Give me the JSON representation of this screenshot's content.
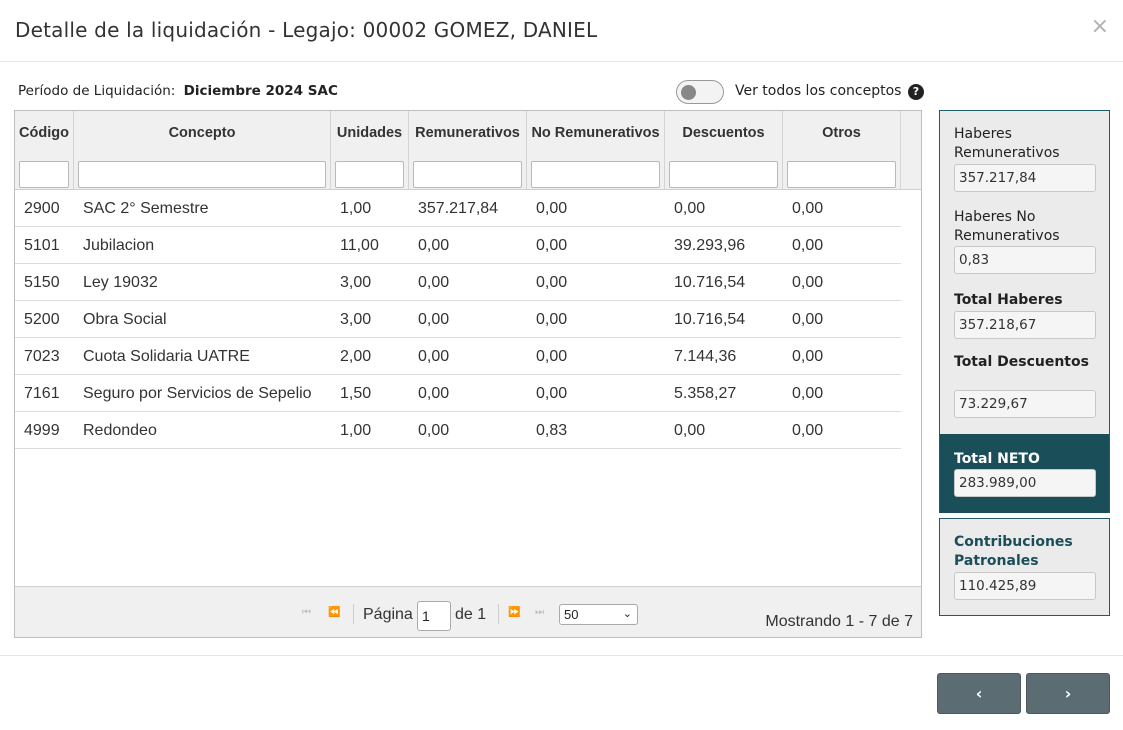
{
  "header": {
    "title": "Detalle de la liquidación - Legajo: 00002 GOMEZ, DANIEL",
    "close_glyph": "×"
  },
  "period": {
    "label": "Período de Liquidación:",
    "value": "Diciembre 2024 SAC"
  },
  "toggle": {
    "label": "Ver todos los conceptos",
    "checked": false
  },
  "help_glyph": "?",
  "table": {
    "columns": [
      "Código",
      "Concepto",
      "Unidades",
      "Remunerativos",
      "No Remunerativos",
      "Descuentos",
      "Otros"
    ],
    "rows": [
      [
        "2900",
        "SAC 2° Semestre",
        "1,00",
        "357.217,84",
        "0,00",
        "0,00",
        "0,00"
      ],
      [
        "5101",
        "Jubilacion",
        "11,00",
        "0,00",
        "0,00",
        "39.293,96",
        "0,00"
      ],
      [
        "5150",
        "Ley 19032",
        "3,00",
        "0,00",
        "0,00",
        "10.716,54",
        "0,00"
      ],
      [
        "5200",
        "Obra Social",
        "3,00",
        "0,00",
        "0,00",
        "10.716,54",
        "0,00"
      ],
      [
        "7023",
        "Cuota Solidaria UATRE",
        "2,00",
        "0,00",
        "0,00",
        "7.144,36",
        "0,00"
      ],
      [
        "7161",
        "Seguro por Servicios de Sepelio",
        "1,50",
        "0,00",
        "0,00",
        "5.358,27",
        "0,00"
      ],
      [
        "4999",
        "Redondeo",
        "1,00",
        "0,00",
        "0,83",
        "0,00",
        "0,00"
      ]
    ]
  },
  "pager": {
    "page_label": "Página",
    "page_value": "1",
    "of_label": "de 1",
    "page_size": "50",
    "info": "Mostrando 1 - 7 de 7",
    "first_glyph": "⏮",
    "prev_glyph": "⏪",
    "next_glyph": "⏩",
    "last_glyph": "⏭"
  },
  "summary": {
    "remunerativos_label": "Haberes Remunerativos",
    "remunerativos_value": "357.217,84",
    "no_remunerativos_label": "Haberes No Remunerativos",
    "no_remunerativos_value": "0,83",
    "total_haberes_label": "Total Haberes",
    "total_haberes_value": "357.218,67",
    "total_descuentos_label": "Total Descuentos",
    "total_descuentos_value": "73.229,67",
    "total_neto_label": "Total NETO",
    "total_neto_value": "283.989,00",
    "contribuciones_label": "Contribuciones Patronales",
    "contribuciones_value": "110.425,89"
  },
  "nav": {
    "prev_glyph": "‹",
    "next_glyph": "›"
  },
  "colors": {
    "accent": "#1a4f5a",
    "button": "#5b6c72"
  }
}
